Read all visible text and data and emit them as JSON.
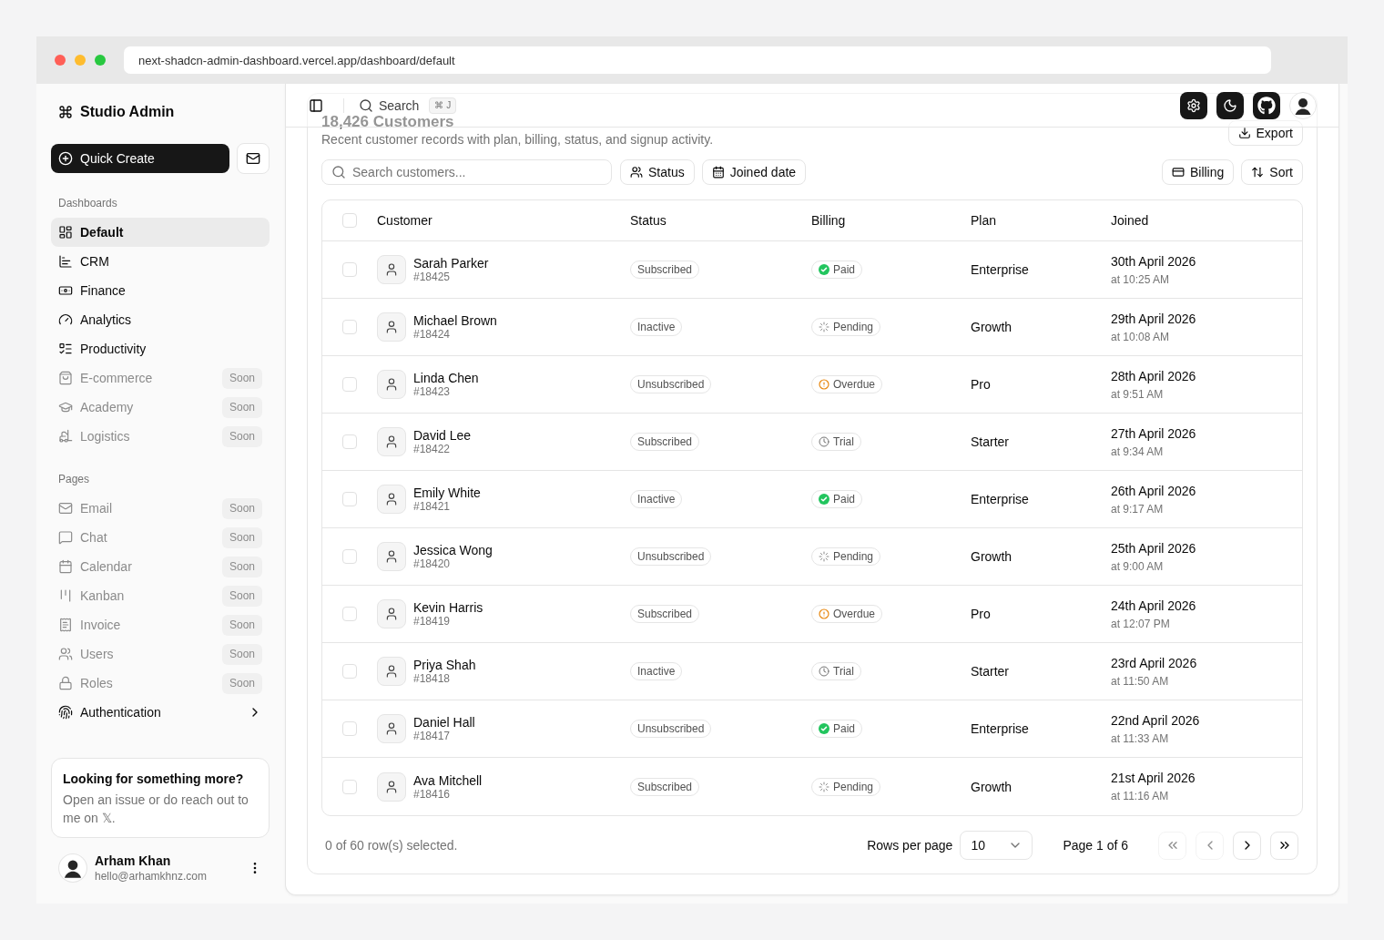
{
  "browser": {
    "url": "next-shadcn-admin-dashboard.vercel.app/dashboard/default"
  },
  "sidebar": {
    "brand": "Studio Admin",
    "quick_create": "Quick Create",
    "groups": [
      {
        "label": "Dashboards",
        "items": [
          {
            "label": "Default",
            "selected": true,
            "disabled": false
          },
          {
            "label": "CRM",
            "selected": false,
            "disabled": false
          },
          {
            "label": "Finance",
            "selected": false,
            "disabled": false
          },
          {
            "label": "Analytics",
            "selected": false,
            "disabled": false
          },
          {
            "label": "Productivity",
            "selected": false,
            "disabled": false
          },
          {
            "label": "E-commerce",
            "selected": false,
            "disabled": true,
            "badge": "Soon"
          },
          {
            "label": "Academy",
            "selected": false,
            "disabled": true,
            "badge": "Soon"
          },
          {
            "label": "Logistics",
            "selected": false,
            "disabled": true,
            "badge": "Soon"
          }
        ]
      },
      {
        "label": "Pages",
        "items": [
          {
            "label": "Email",
            "selected": false,
            "disabled": true,
            "badge": "Soon"
          },
          {
            "label": "Chat",
            "selected": false,
            "disabled": true,
            "badge": "Soon"
          },
          {
            "label": "Calendar",
            "selected": false,
            "disabled": true,
            "badge": "Soon"
          },
          {
            "label": "Kanban",
            "selected": false,
            "disabled": true,
            "badge": "Soon"
          },
          {
            "label": "Invoice",
            "selected": false,
            "disabled": true,
            "badge": "Soon"
          },
          {
            "label": "Users",
            "selected": false,
            "disabled": true,
            "badge": "Soon"
          },
          {
            "label": "Roles",
            "selected": false,
            "disabled": true,
            "badge": "Soon"
          },
          {
            "label": "Authentication",
            "selected": false,
            "disabled": false,
            "expanded": false
          }
        ]
      }
    ],
    "promo": {
      "title": "Looking for something more?",
      "text": "Open an issue or do reach out to me on 𝕏."
    },
    "user": {
      "name": "Arham Khan",
      "email": "hello@arhamkhnz.com"
    }
  },
  "header": {
    "search": {
      "label": "Search",
      "shortcut": "⌘ J"
    }
  },
  "customers": {
    "title": "18,426 Customers",
    "description": "Recent customer records with plan, billing, status, and signup activity.",
    "export": "Export",
    "search": {
      "placeholder": "Search customers..."
    },
    "filters": [
      "Status",
      "Joined date"
    ],
    "view_options": [
      "Billing",
      "Sort"
    ],
    "table": {
      "header_checked": false,
      "columns": [
        "Customer",
        "Status",
        "Billing",
        "Plan",
        "Joined"
      ],
      "rows": [
        {
          "checked": false,
          "name": "Sarah Parker",
          "id": "#18425",
          "status": "Subscribed",
          "billing": {
            "label": "Paid",
            "kind": "paid"
          },
          "plan": "Enterprise",
          "joined_date": "30th April 2026",
          "joined_time": "at 10:25 AM"
        },
        {
          "checked": false,
          "name": "Michael Brown",
          "id": "#18424",
          "status": "Inactive",
          "billing": {
            "label": "Pending",
            "kind": "pending"
          },
          "plan": "Growth",
          "joined_date": "29th April 2026",
          "joined_time": "at 10:08 AM"
        },
        {
          "checked": false,
          "name": "Linda Chen",
          "id": "#18423",
          "status": "Unsubscribed",
          "billing": {
            "label": "Overdue",
            "kind": "overdue"
          },
          "plan": "Pro",
          "joined_date": "28th April 2026",
          "joined_time": "at 9:51 AM"
        },
        {
          "checked": false,
          "name": "David Lee",
          "id": "#18422",
          "status": "Subscribed",
          "billing": {
            "label": "Trial",
            "kind": "trial"
          },
          "plan": "Starter",
          "joined_date": "27th April 2026",
          "joined_time": "at 9:34 AM"
        },
        {
          "checked": false,
          "name": "Emily White",
          "id": "#18421",
          "status": "Inactive",
          "billing": {
            "label": "Paid",
            "kind": "paid"
          },
          "plan": "Enterprise",
          "joined_date": "26th April 2026",
          "joined_time": "at 9:17 AM"
        },
        {
          "checked": false,
          "name": "Jessica Wong",
          "id": "#18420",
          "status": "Unsubscribed",
          "billing": {
            "label": "Pending",
            "kind": "pending"
          },
          "plan": "Growth",
          "joined_date": "25th April 2026",
          "joined_time": "at 9:00 AM"
        },
        {
          "checked": false,
          "name": "Kevin Harris",
          "id": "#18419",
          "status": "Subscribed",
          "billing": {
            "label": "Overdue",
            "kind": "overdue"
          },
          "plan": "Pro",
          "joined_date": "24th April 2026",
          "joined_time": "at 12:07 PM"
        },
        {
          "checked": false,
          "name": "Priya Shah",
          "id": "#18418",
          "status": "Inactive",
          "billing": {
            "label": "Trial",
            "kind": "trial"
          },
          "plan": "Starter",
          "joined_date": "23rd April 2026",
          "joined_time": "at 11:50 AM"
        },
        {
          "checked": false,
          "name": "Daniel Hall",
          "id": "#18417",
          "status": "Unsubscribed",
          "billing": {
            "label": "Paid",
            "kind": "paid"
          },
          "plan": "Enterprise",
          "joined_date": "22nd April 2026",
          "joined_time": "at 11:33 AM"
        },
        {
          "checked": false,
          "name": "Ava Mitchell",
          "id": "#18416",
          "status": "Subscribed",
          "billing": {
            "label": "Pending",
            "kind": "pending"
          },
          "plan": "Growth",
          "joined_date": "21st April 2026",
          "joined_time": "at 11:16 AM"
        }
      ]
    },
    "footer": {
      "selection": "0 of 60 row(s) selected.",
      "rows_per_page_label": "Rows per page",
      "rows_per_page": "10",
      "page": "Page 1 of 6"
    },
    "pagination": [
      {
        "kind": "first",
        "disabled": true
      },
      {
        "kind": "previous",
        "disabled": true
      },
      {
        "kind": "next",
        "disabled": false
      },
      {
        "kind": "last",
        "disabled": false
      }
    ]
  }
}
